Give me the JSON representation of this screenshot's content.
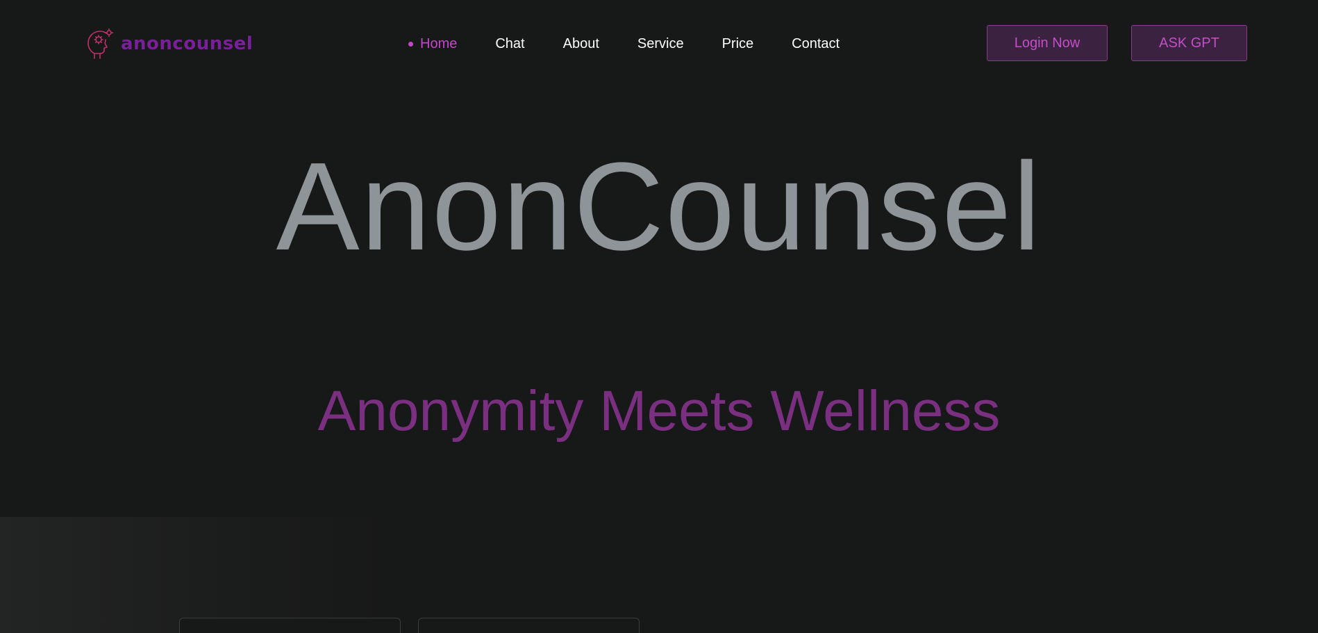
{
  "header": {
    "logo_text": "anoncounsel",
    "logo_icon": "head-with-gears-icon",
    "nav": [
      {
        "label": "Home",
        "active": true
      },
      {
        "label": "Chat",
        "active": false
      },
      {
        "label": "About",
        "active": false
      },
      {
        "label": "Service",
        "active": false
      },
      {
        "label": "Price",
        "active": false
      },
      {
        "label": "Contact",
        "active": false
      }
    ],
    "login_label": "Login Now",
    "ask_gpt_label": "ASK GPT"
  },
  "hero": {
    "title": "AnonCounsel",
    "subtitle": "Anonymity Meets Wellness"
  },
  "colors": {
    "background": "#171818",
    "accent": "#c447c9",
    "logo": "#7a1f9a",
    "title": "#8f9498",
    "subtitle": "#7a2f80",
    "button_bg": "#3b2240",
    "button_border": "#8a3a8f"
  }
}
